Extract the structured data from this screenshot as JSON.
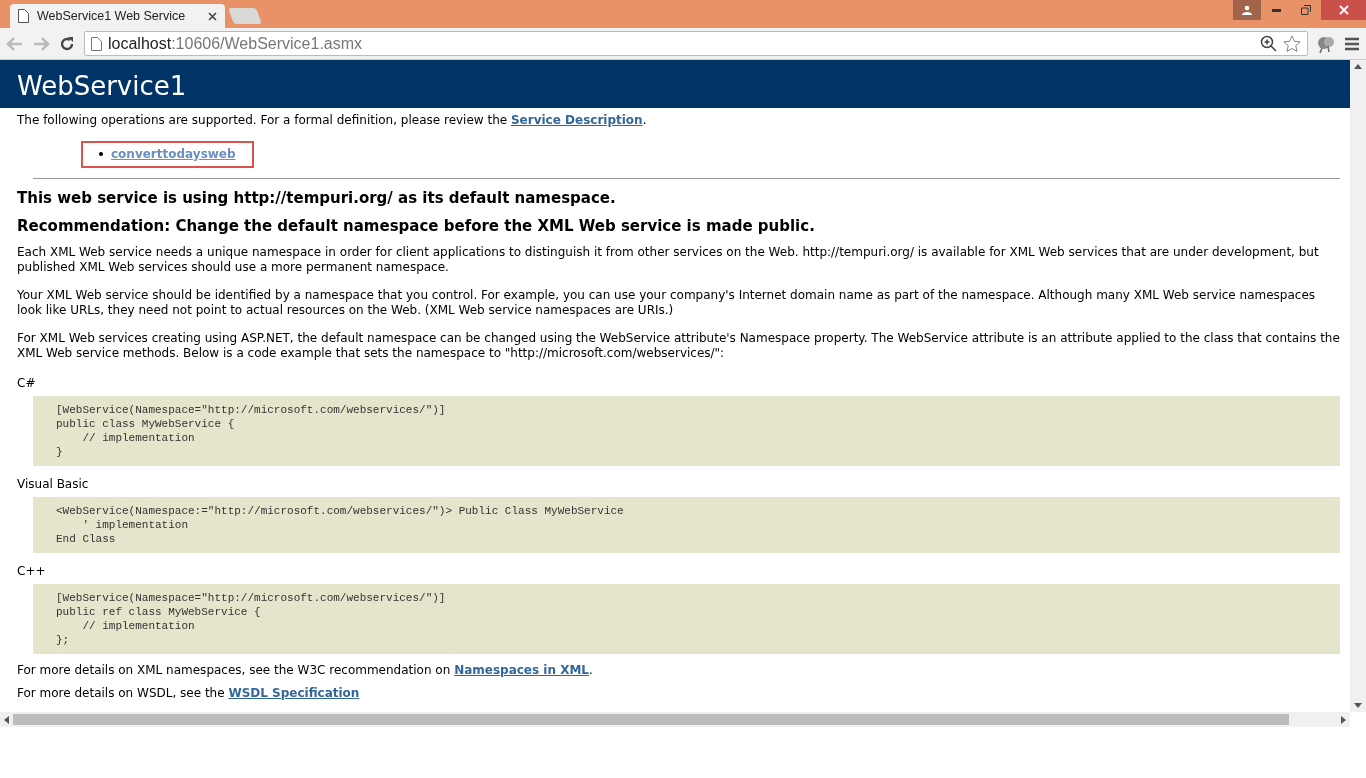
{
  "window": {
    "tab": {
      "title": "WebService1 Web Service",
      "selected": true
    },
    "address": {
      "host": "localhost",
      "path": ":10606/WebService1.asmx"
    }
  },
  "page": {
    "title": "WebService1",
    "intro": {
      "text": "The following operations are supported. For a formal definition, please review the ",
      "link": "Service Description",
      "tail": "."
    },
    "operations": [
      {
        "label": "converttodaysweb",
        "highlighted": true
      }
    ],
    "headings": [
      "This web service is using http://tempuri.org/ as its default namespace.",
      "Recommendation: Change the default namespace before the XML Web service is made public."
    ],
    "paragraphs": [
      "Each XML Web service needs a unique namespace in order for client applications to distinguish it from other services on the Web. http://tempuri.org/ is available for XML Web services that are under development, but published XML Web services should use a more permanent namespace.",
      "Your XML Web service should be identified by a namespace that you control. For example, you can use your company's Internet domain name as part of the namespace. Although many XML Web service namespaces look like URLs, they need not point to actual resources on the Web. (XML Web service namespaces are URIs.)",
      "For XML Web services creating using ASP.NET, the default namespace can be changed using the WebService attribute's Namespace property. The WebService attribute is an attribute applied to the class that contains the XML Web service methods. Below is a code example that sets the namespace to \"http://microsoft.com/webservices/\":"
    ],
    "samples": [
      {
        "language": "C#",
        "lines": [
          "[WebService(Namespace=\"http://microsoft.com/webservices/\")]",
          "public class MyWebService {",
          "    // implementation",
          "}"
        ]
      },
      {
        "language": "Visual Basic",
        "lines": [
          "<WebService(Namespace:=\"http://microsoft.com/webservices/\")> Public Class MyWebService",
          "    ' implementation",
          "End Class"
        ]
      },
      {
        "language": "C++",
        "lines": [
          "[WebService(Namespace=\"http://microsoft.com/webservices/\")]",
          "public ref class MyWebService {",
          "    // implementation",
          "};"
        ]
      }
    ],
    "footer": [
      {
        "text": "For more details on XML namespaces, see the W3C recommendation on ",
        "link": "Namespaces in XML",
        "tail": "."
      },
      {
        "text": "For more details on WSDL, see the ",
        "link": "WSDL Specification"
      }
    ]
  }
}
